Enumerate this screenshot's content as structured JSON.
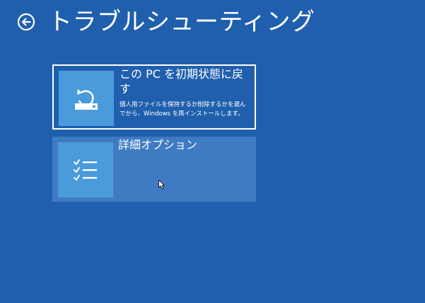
{
  "header": {
    "title": "トラブルシューティング",
    "back_icon": "back-arrow-circle-icon"
  },
  "options": [
    {
      "title": "この PC を初期状態に戻す",
      "description": "個人用ファイルを保持するか削除するかを選んでから、Windows を再インストールします。",
      "icon": "reset-pc-icon",
      "selected": true
    },
    {
      "title": "詳細オプション",
      "description": "",
      "icon": "checklist-icon",
      "selected": false
    }
  ],
  "colors": {
    "background": "#1f5fae",
    "tile_icon_bg": "#4a9bdc",
    "tile_hover_bg": "#3f7bc2",
    "text": "#ffffff"
  }
}
